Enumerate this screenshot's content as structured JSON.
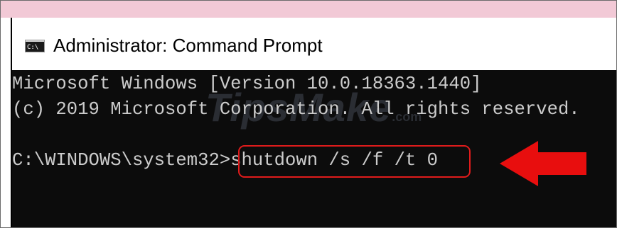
{
  "window": {
    "title": "Administrator: Command Prompt",
    "icon": "console-icon",
    "icon_label": "C:\\"
  },
  "console": {
    "line1": "Microsoft Windows [Version 10.0.18363.1440]",
    "line2": "(c) 2019 Microsoft Corporation. All rights reserved.",
    "prompt": "C:\\WINDOWS\\system32>",
    "command": "shutdown /s /f /t 0"
  },
  "watermark": {
    "text": "TipsMake",
    "suffix": ".com"
  },
  "colors": {
    "console_bg": "#0c0c0c",
    "console_text": "#cccccc",
    "highlight": "#e01b1b",
    "top_strip": "#f2c9d6"
  }
}
